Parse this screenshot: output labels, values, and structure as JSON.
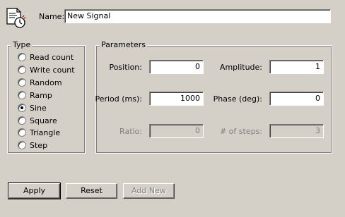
{
  "header": {
    "icon": "signal-document-clock-icon",
    "name_label": "Name:",
    "name_value": "New Signal"
  },
  "type_group": {
    "title": "Type",
    "options": [
      {
        "label": "Read count",
        "checked": false
      },
      {
        "label": "Write count",
        "checked": false
      },
      {
        "label": "Random",
        "checked": false
      },
      {
        "label": "Ramp",
        "checked": false
      },
      {
        "label": "Sine",
        "checked": true
      },
      {
        "label": "Square",
        "checked": false
      },
      {
        "label": "Triangle",
        "checked": false
      },
      {
        "label": "Step",
        "checked": false
      }
    ]
  },
  "parameters": {
    "title": "Parameters",
    "position": {
      "label": "Position:",
      "value": "0"
    },
    "amplitude": {
      "label": "Amplitude:",
      "value": "1"
    },
    "period": {
      "label": "Period (ms):",
      "value": "1000"
    },
    "phase": {
      "label": "Phase (deg):",
      "value": "0"
    },
    "ratio": {
      "label": "Ratio:",
      "value": "0",
      "enabled": false
    },
    "steps": {
      "label": "# of steps:",
      "value": "3",
      "enabled": false
    }
  },
  "buttons": {
    "apply": "Apply",
    "reset": "Reset",
    "add_new": "Add New"
  }
}
